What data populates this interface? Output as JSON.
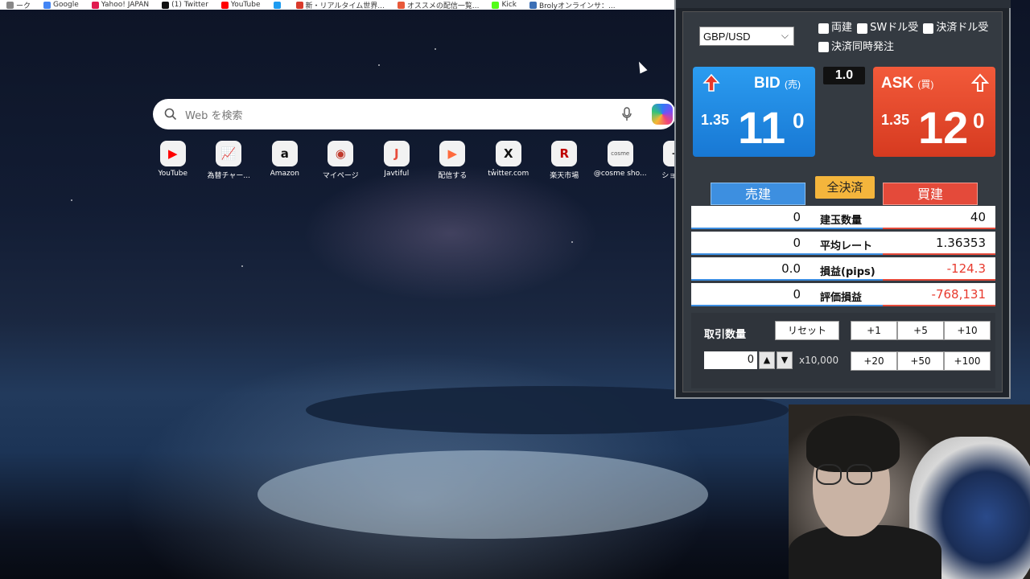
{
  "bookmarks": [
    {
      "label": "ーク",
      "color": "#888888"
    },
    {
      "label": "Google",
      "color": "#4285f4"
    },
    {
      "label": "Yahoo! JAPAN",
      "color": "#e01b4f"
    },
    {
      "label": "(1) Twitter",
      "color": "#111111"
    },
    {
      "label": "YouTube",
      "color": "#ff0000"
    },
    {
      "label": "",
      "color": "#1d9bf0"
    },
    {
      "label": "新・リアルタイム世界...",
      "color": "#d93a2b"
    },
    {
      "label": "オススメの配信一覧...",
      "color": "#e8593a"
    },
    {
      "label": "Kick",
      "color": "#53fc18"
    },
    {
      "label": "Brolyオンラインサ：...",
      "color": "#3b6fb5"
    }
  ],
  "search": {
    "placeholder": "Web を検索"
  },
  "shortcuts": [
    {
      "label": "YouTube",
      "icon": "▶",
      "color": "#ff0000"
    },
    {
      "label": "為替チャー...",
      "icon": "📈",
      "color": "#d6336c"
    },
    {
      "label": "Amazon",
      "icon": "a",
      "color": "#111111"
    },
    {
      "label": "マイページ",
      "icon": "◉",
      "color": "#c0392b"
    },
    {
      "label": "Javtiful",
      "icon": "J",
      "color": "#e74c3c"
    },
    {
      "label": "配信する",
      "icon": "▶",
      "color": "#ff6a3d"
    },
    {
      "label": "twitter.com",
      "icon": "X",
      "color": "#111111"
    },
    {
      "label": "楽天市場",
      "icon": "R",
      "color": "#bf0000"
    },
    {
      "label": "@cosme sho...",
      "icon": "cosme",
      "color": "#555555"
    },
    {
      "label": "ショート",
      "icon": "+",
      "color": "#333333"
    }
  ],
  "trade": {
    "pair": "GBP/USD",
    "options": [
      "両建",
      "SWドル受",
      "決済ドル受",
      "決済同時発注"
    ],
    "bid": {
      "title": "BID",
      "sub": "(売)",
      "pre": "1.35",
      "big": "11",
      "sup": "0"
    },
    "ask": {
      "title": "ASK",
      "sub": "(買)",
      "pre": "1.35",
      "big": "12",
      "sup": "0"
    },
    "spread": "1.0",
    "sell_header": "売建",
    "buy_header": "買建",
    "close_all": "全決済",
    "rows": [
      {
        "sell": "0",
        "label": "建玉数量",
        "buy": "40",
        "neg": false
      },
      {
        "sell": "0",
        "label": "平均レート",
        "buy": "1.36353",
        "neg": false
      },
      {
        "sell": "0.0",
        "label": "損益(pips)",
        "buy": "-124.3",
        "neg": true
      },
      {
        "sell": "0",
        "label": "評価損益",
        "buy": "-768,131",
        "neg": true
      }
    ],
    "qty_label": "取引数量",
    "reset": "リセット",
    "qty_value": "0",
    "unit": "x10,000",
    "inc_row1": [
      "+1",
      "+5",
      "+10"
    ],
    "inc_row2": [
      "+20",
      "+50",
      "+100"
    ]
  },
  "colors": {
    "bid": "#1e86e0",
    "ask": "#e0452a",
    "negative": "#e83a2e",
    "close_all": "#f4b53c"
  }
}
